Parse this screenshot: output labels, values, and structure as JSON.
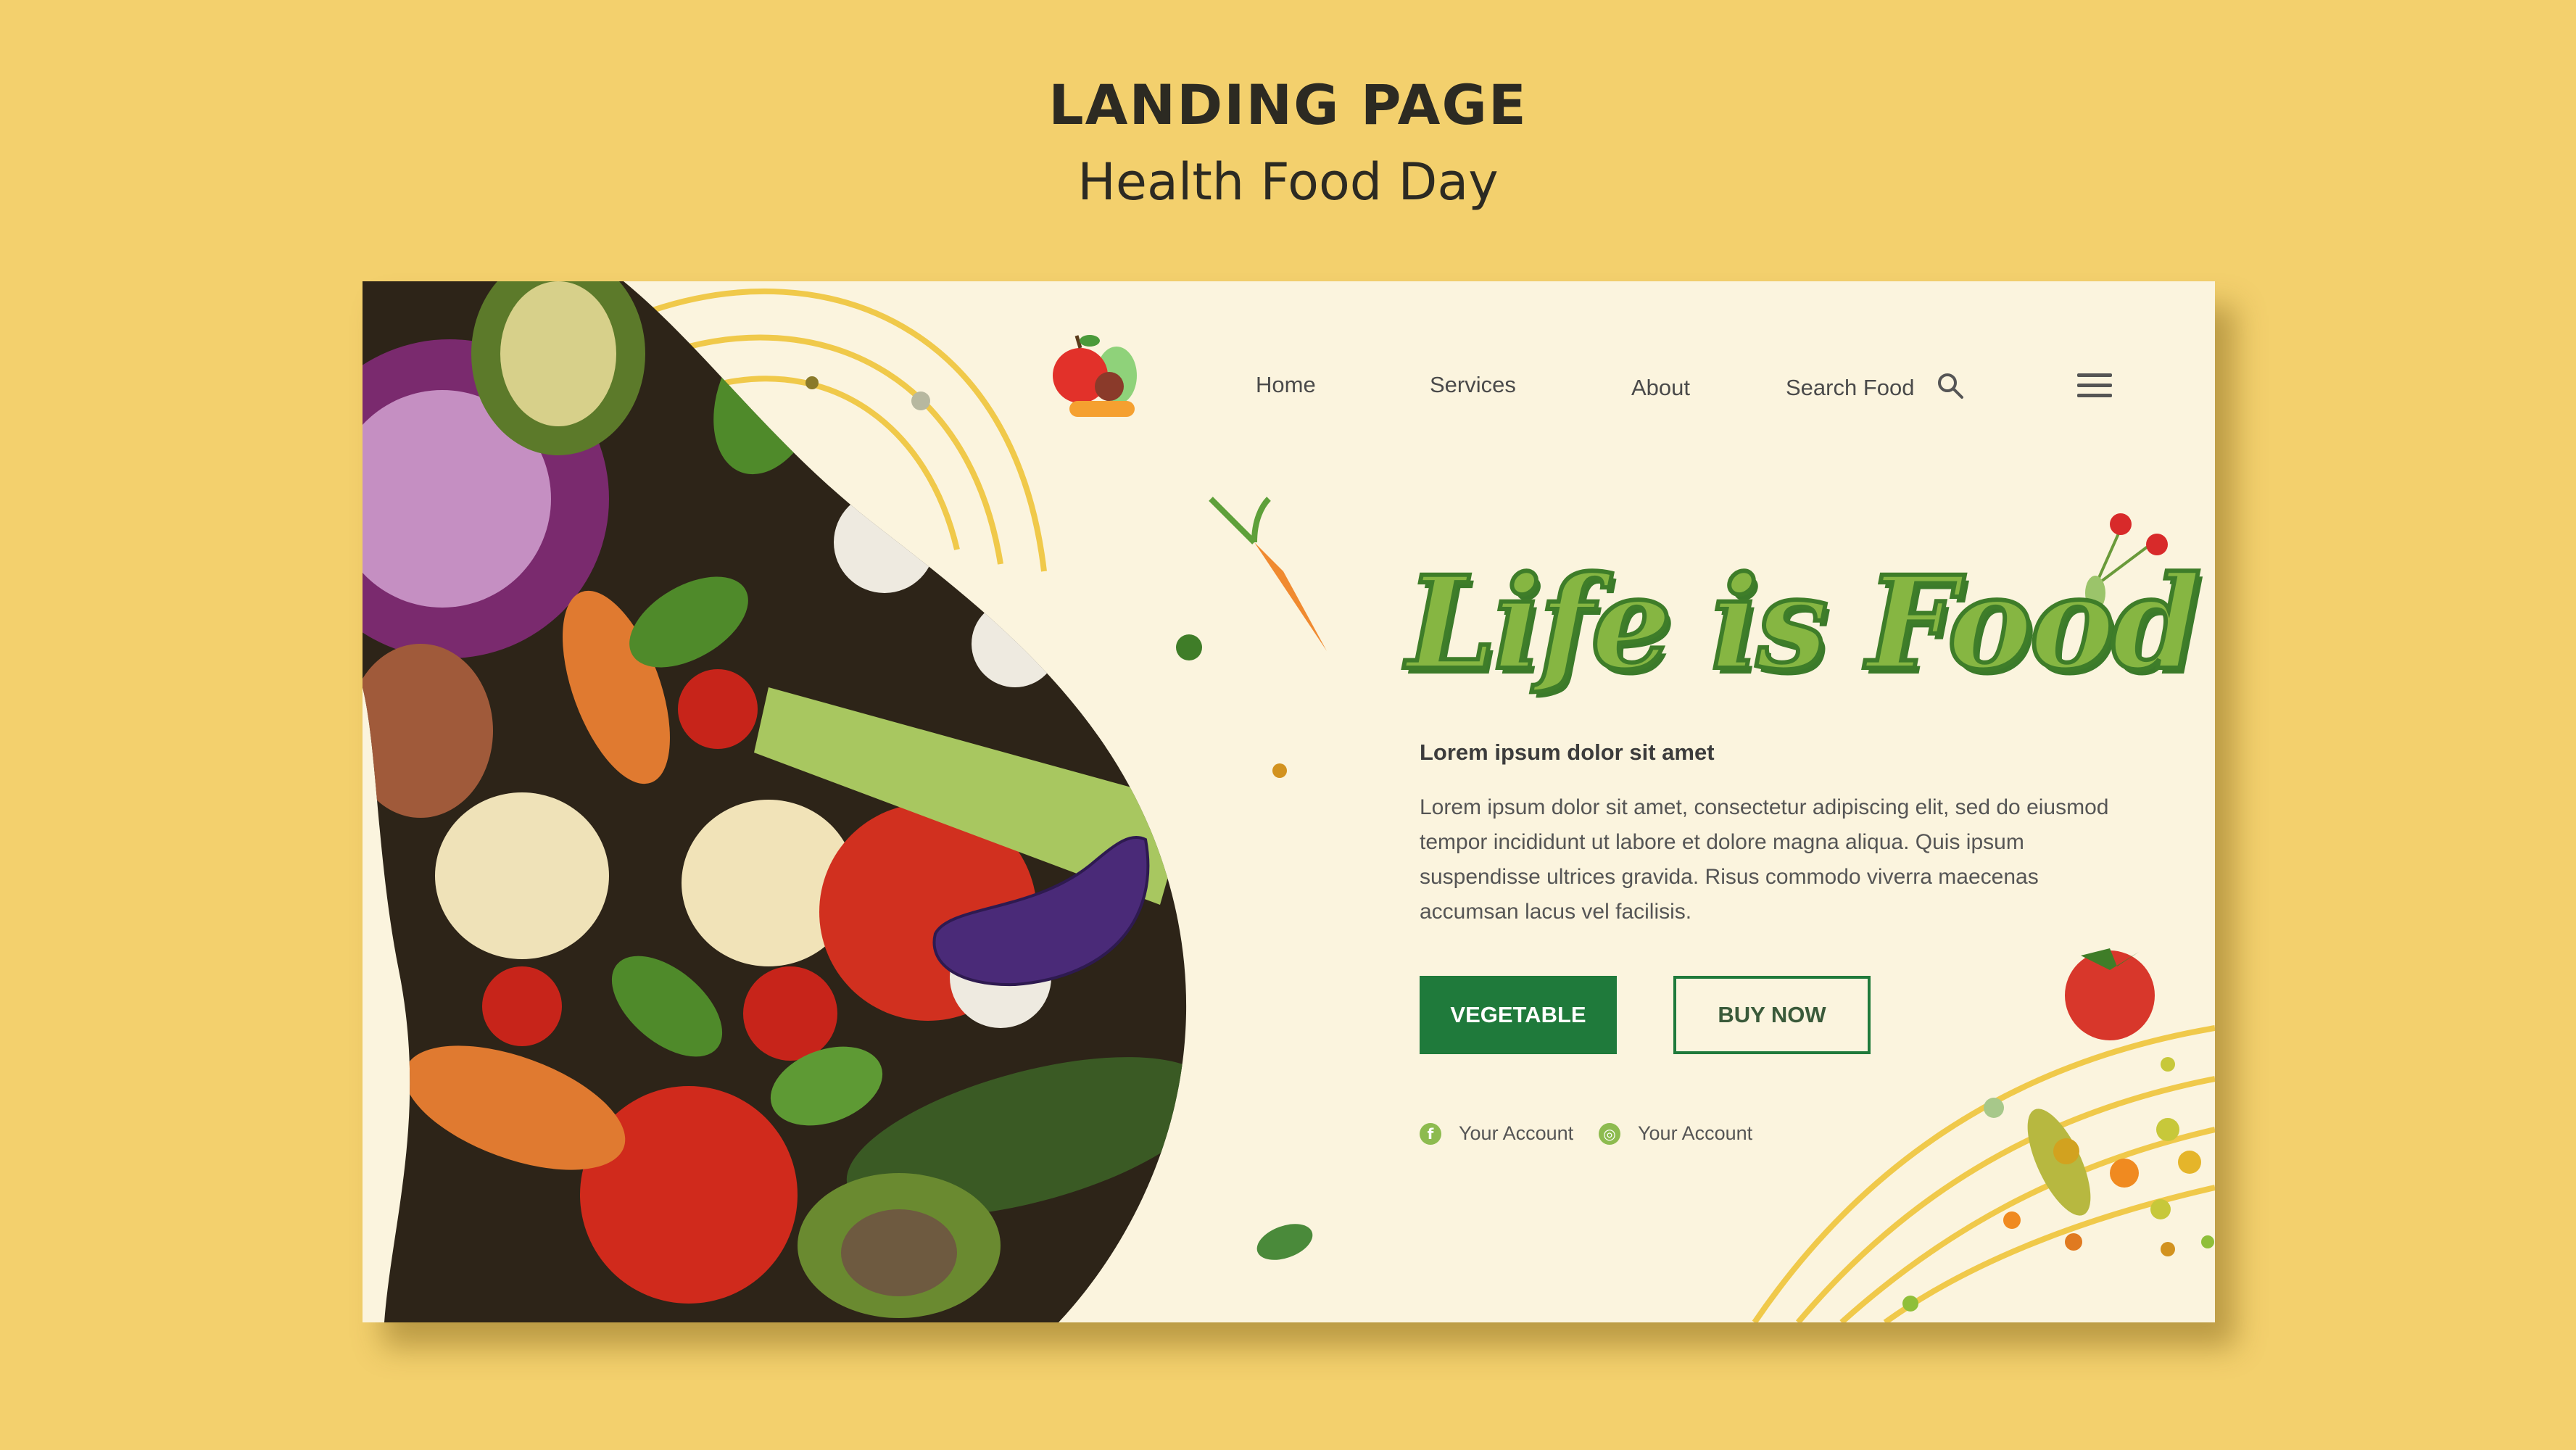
{
  "header": {
    "title": "LANDING PAGE",
    "subtitle": "Health Food Day"
  },
  "nav": {
    "items": [
      {
        "label": "Home"
      },
      {
        "label": "Services"
      },
      {
        "label": "About"
      }
    ],
    "search_label": "Search Food",
    "logo_icon": "fruit-basket-icon",
    "search_icon": "search-icon",
    "menu_icon": "hamburger-menu-icon"
  },
  "hero": {
    "heading": "Life is Food",
    "subheading": "Lorem ipsum dolor sit amet",
    "body": "Lorem ipsum dolor sit amet, consectetur adipiscing elit, sed do eiusmod tempor incididunt ut labore et dolore magna aliqua. Quis ipsum suspendisse ultrices gravida. Risus commodo viverra maecenas accumsan lacus vel facilisis.",
    "primary_button": "VEGETABLE",
    "secondary_button": "BUY NOW"
  },
  "social": [
    {
      "icon": "facebook-icon",
      "glyph": "f",
      "label": "Your Account"
    },
    {
      "icon": "instagram-icon",
      "glyph": "◎",
      "label": "Your Account"
    }
  ],
  "colors": {
    "background": "#f3d06d",
    "card": "#fbf4de",
    "accent_green": "#1f7a3b",
    "heading_green": "#86b642",
    "line_yellow": "#f0c94a"
  }
}
